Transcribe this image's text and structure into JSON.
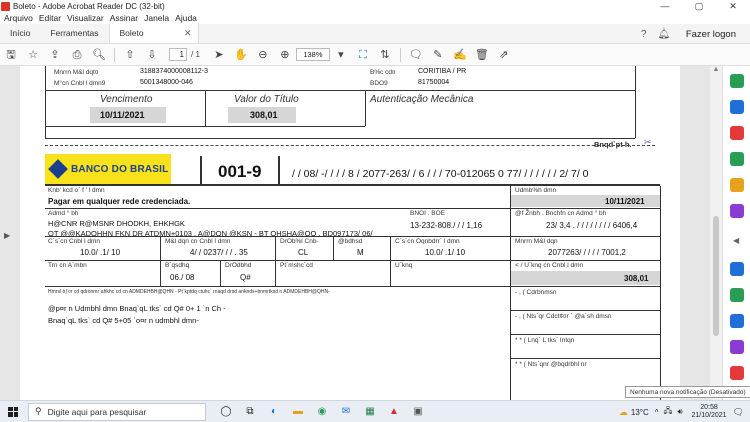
{
  "window": {
    "title": "Boleto - Adobe Acrobat Reader DC (32-bit)",
    "minimize": "—",
    "maximize": "▢",
    "close": "✕"
  },
  "menu": [
    "Arquivo",
    "Editar",
    "Visualizar",
    "Assinar",
    "Janela",
    "Ajuda"
  ],
  "tabs": {
    "home": "Início",
    "tools": "Ferramentas",
    "document": "Boleto",
    "close": "✕",
    "login": "Fazer logon"
  },
  "toolbar": {
    "page_current": "1",
    "page_total": "/ 1",
    "zoom": "138%"
  },
  "doc": {
    "top": {
      "row1_label": "Mnrrn M&l dqt¤",
      "row1_value": "3188374000008112-3",
      "row1_right_label": "B%c cd¤",
      "row1_right_value": "CORITIBA / PR",
      "row2_label": "M°cn Cnbl l dmn9",
      "row2_value": "5001348000-046",
      "row2_right_label": "BDO9",
      "row2_right_value": "81750004",
      "vencimento_label": "Vencimento",
      "vencimento_value": "10/11/2021",
      "valor_label": "Valor do Título",
      "valor_value": "308,01",
      "autent_label": "Autenticação Mecânica",
      "cut_label": "Bnqd`pt h."
    },
    "bank": {
      "logo_text": "BANCO DO BRASIL",
      "code": "001-9",
      "line": "/ / 08/ -/ / / / 8  / 2077-263/ / 6  / / / 70-012065  0  77/ / / / / / / 2/ 7/ 0"
    },
    "fields": {
      "local_label": "Knb' kcd o` f ' l  dmn",
      "local_value": "Pagar em qualquer rede credenciada.",
      "venc_label": "Udmb%h dmn",
      "venc_value": "10/11/2021",
      "benef_label": "Admd ° bh",
      "benef_line1": "H@CNR R@MSNR DHODKH, EHKHGK",
      "benef_line2": "OT @@KADOHHN FKN DR ATDMN+0103 , A@DON @KSN - BT OHSHA@OO , BD097173/ 06/",
      "benef_code_label": "BNOI . BOE",
      "benef_code_value": "13-232-808./ / / 1,16",
      "agencia_label": "@f Žnbh . Bnchfn cn Admd ° bh",
      "agencia_value": "23/ 3,4 . / / / / / / / / 6406,4",
      "data_doc_label": "C`s`cn Cnbl l dmn",
      "data_doc_value": "10.0/ .1/ 10",
      "num_doc_label": "M&l dqn cn Cnbl l dmn",
      "num_doc_value": "4/ / 0237/ / / . 35",
      "esp_doc_label": "DrOb%l Cnb-",
      "esp_doc_value": "CL",
      "aceite_label": "@bdhsd",
      "aceite_value": "M",
      "data_proc_label": "C`s`cn Oqnbdrr` l dmn",
      "data_proc_value": "10.0/ .1/ 10",
      "nosso_label": "Mnrrn M&l dqn",
      "nosso_value": "2077263/ / / / / 7001,2",
      "uso_label": "Trn cn A`mbn",
      "carteira_label": "B`qsdhq",
      "carteira_value": "06./ 08",
      "especie_label": "DrOdbhd",
      "especie_value": "Q#",
      "qtd_label": "Pt`mshc`cd",
      "valor_label": "U`knq",
      "valor_doc_label": "< / U`knq cn Cnbl l dmn",
      "valor_doc_value": "308,01",
      "instr_label": "Hmrsl bƒ¤r cd qdronmr`ahkhc`cd cn ADMDEHBH@QHN - Pt`kptdq ctuhc` rnaqd drsd anknds+bnmrtksd n ADMDEHBH@QHN-",
      "instr_line1": "@p¤r n Udmbhl dmn Bnaq`qL tks` cd Q# 0+ 1 `n Ch -",
      "instr_line2": "Bnaq`qL tks` cd Q# 5+05 `o¤r n udmbhl dmn-",
      "desc_label": "- , ( Cdrbnmsn",
      "deduc_label": "- , ( Nts`qr Cdct¢¤r  ` @a`sh dmsn",
      "mora_label": "* * ( Lnq` L tks` Intqn",
      "acres_label": "* * ( Nts`qnr @bqdrbhl nr"
    }
  },
  "taskbar": {
    "search_placeholder": "Digite aqui para pesquisar",
    "temperature": "13°C",
    "time": "20:58",
    "date": "21/10/2021",
    "notification": "Nenhuma nova notificação (Desativado)"
  },
  "colors": {
    "bb_yellow": "#f9e21a",
    "bb_blue": "#1b3f8f",
    "acrobat_red": "#d32f2f",
    "link_blue": "#1a73c9"
  }
}
